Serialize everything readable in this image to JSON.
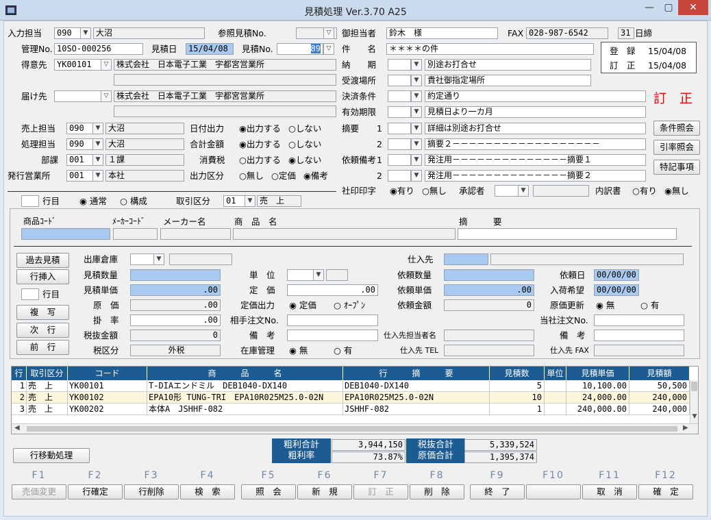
{
  "window": {
    "title": "見積処理 Ver.3.70 A25",
    "min": "—",
    "max": "▢",
    "close": "✕"
  },
  "header": {
    "input_staff_label": "入力担当",
    "input_staff_code": "090",
    "input_staff_name": "大沼",
    "ref_estimate_label": "参照見積No.",
    "customer_staff_label": "御担当者",
    "customer_staff": "鈴木　様",
    "fax_label": "FAX",
    "fax": "028-987-6542",
    "close_day": "31",
    "close_label": "日締",
    "mgmt_label": "管理No.",
    "mgmt_no": "10SO-000256",
    "est_date_label": "見積日",
    "est_date": "15/04/08",
    "est_no_label": "見積No.",
    "est_no": "89",
    "subject_label": "件　　名",
    "subject": "＊＊＊＊の件",
    "reg_label": "登　録",
    "reg_date": "15/04/08",
    "fix_label": "訂　正",
    "fix_date": "15/04/08",
    "client_label": "得意先",
    "client_code": "YK00101",
    "client_name": "株式会社　日本電子工業　宇都宮営業所",
    "delivery_label": "納　　期",
    "delivery": "別途お打合せ",
    "receive_label": "受渡場所",
    "receive": "貴社御指定場所",
    "ship_label": "届け先",
    "ship_name": "株式会社　日本電子工業　宇都宮営業所",
    "payment_label": "決済条件",
    "payment": "約定通り",
    "status_text": "訂　正",
    "valid_label": "有効期限",
    "valid": "見積日より一カ月",
    "sales_label": "売上担当",
    "sales_code": "090",
    "sales_name": "大沼",
    "datefmt_label": "日付出力",
    "out_yes": "◉出力する",
    "out_no": "○しない",
    "memo_label": "摘要",
    "memo1_no": "1",
    "memo1": "詳細は別途お打合せ",
    "cond_btn": "条件照会",
    "proc_label": "処理担当",
    "proc_code": "090",
    "proc_name": "大沼",
    "total_label": "合計金額",
    "total_yes": "◉出力する",
    "total_no": "○しない",
    "memo2_no": "2",
    "memo2": "摘要２－－－－－－－－－－－－－－－－－－",
    "rate_btn": "引率照会",
    "dept_label": "部課",
    "dept_code": "001",
    "dept_name": "１課",
    "tax_label": "消費税",
    "tax_yes": "○出力する",
    "tax_no": "◉しない",
    "req_label": "依頼備考",
    "req1_no": "1",
    "req1": "発注用－－－－－－－－－－－－－－摘要１",
    "special_btn": "特記事項",
    "branch_label": "発行営業所",
    "branch_code": "001",
    "branch_name": "本社",
    "outtype_label": "出力区分",
    "ot_none": "○無し",
    "ot_fixed": "○定価",
    "ot_note": "◉備考",
    "req2_no": "2",
    "req2": "発注用－－－－－－－－－－－－－－摘要２",
    "stamp_label": "社印印字",
    "stamp_yes": "◉有り",
    "stamp_no": "○無し",
    "approver_label": "承認者",
    "detail_label": "内訳書",
    "detail_yes": "○有り",
    "detail_no": "◉無し"
  },
  "line": {
    "row_label": "行目",
    "normal": "◉ 通常",
    "compose": "○ 構成",
    "txn_label": "取引区分",
    "txn_code": "01",
    "txn_name": "売　上",
    "col_prod_code": "商品ｺｰﾄﾞ",
    "col_maker_code": "ﾒｰｶｰｺｰﾄﾞ",
    "col_maker": "メーカー名",
    "col_prod": "商　品　名",
    "col_memo": "摘　　　要"
  },
  "side_buttons": [
    "過去見積",
    "行挿入",
    "複　写",
    "次　行",
    "前　行"
  ],
  "side_row_label": "行目",
  "form": {
    "warehouse": "出庫倉庫",
    "qty": "見積数量",
    "price": "見積単価",
    "price_val": ".00",
    "cost": "原　価",
    "cost_val": ".00",
    "rate": "掛　率",
    "rate_val": ".00",
    "excl": "税抜金額",
    "excl_val": "0",
    "taxcls": "税区分",
    "taxcls_val": "外税",
    "unit": "単　位",
    "list": "定　価",
    "list_val": ".00",
    "listout": "定価出力",
    "lo_fixed": "◉ 定価",
    "lo_open": "○ ｵｰﾌﾟﾝ",
    "other_no": "相手注文No.",
    "note": "備　考",
    "stock": "在庫管理",
    "stock_no": "◉ 無",
    "stock_yes": "○ 有",
    "supplier": "仕入先",
    "req_qty": "依頼数量",
    "req_price": "依頼単価",
    "req_price_val": ".00",
    "req_amount": "依頼金額",
    "req_amount_val": "0",
    "sup_staff": "仕入先担当者名",
    "sup_tel": "仕入先 TEL",
    "req_date": "依頼日",
    "req_date_val": "00/00/00",
    "arrive": "入荷希望",
    "arrive_val": "00/00/00",
    "cost_upd": "原価更新",
    "cu_no": "◉ 無",
    "cu_yes": "○ 有",
    "our_no": "当社注文No.",
    "note2": "備　考",
    "sup_fax": "仕入先 FAX"
  },
  "table": {
    "headers": [
      "行",
      "取引区分",
      "コード",
      "商　　　品　　　名",
      "行　　　摘　　　要",
      "見積数",
      "単位",
      "見積単価",
      "見積額"
    ],
    "rows": [
      [
        "1",
        "売　上",
        "YK00101",
        "T-DIAエンドミル　DEB1040-DX140",
        "DEB1040-DX140",
        "5",
        "",
        "10,100.00",
        "50,500"
      ],
      [
        "2",
        "売　上",
        "YK00102",
        "EPA10形 TUNG-TRI　EPA10R025M25.0-02N",
        "EPA10R025M25.0-02N",
        "10",
        "",
        "24,000.00",
        "240,000"
      ],
      [
        "3",
        "売　上",
        "YK00202",
        "本体A　JSHHF-082",
        "JSHHF-082",
        "1",
        "",
        "240,000.00",
        "240,000"
      ]
    ]
  },
  "totals": {
    "gross_label": "粗利合計",
    "gross": "3,944,150",
    "gross_rate_label": "粗利率",
    "gross_rate": "73.87%",
    "excl_label": "税抜合計",
    "excl": "5,339,524",
    "cost_label": "原価合計",
    "cost": "1,395,374"
  },
  "move_btn": "行移動処理",
  "fkeys": [
    {
      "key": "F1",
      "label": "売価変更",
      "enabled": false
    },
    {
      "key": "F2",
      "label": "行確定",
      "enabled": true
    },
    {
      "key": "F3",
      "label": "行削除",
      "enabled": true
    },
    {
      "key": "F4",
      "label": "検　索",
      "enabled": true
    },
    {
      "key": "F5",
      "label": "照　会",
      "enabled": true
    },
    {
      "key": "F6",
      "label": "新　規",
      "enabled": true
    },
    {
      "key": "F7",
      "label": "訂　正",
      "enabled": false
    },
    {
      "key": "F8",
      "label": "削　除",
      "enabled": true
    },
    {
      "key": "F9",
      "label": "終　了",
      "enabled": true
    },
    {
      "key": "F10",
      "label": "",
      "enabled": false
    },
    {
      "key": "F11",
      "label": "取　消",
      "enabled": true
    },
    {
      "key": "F12",
      "label": "確　定",
      "enabled": true
    }
  ]
}
